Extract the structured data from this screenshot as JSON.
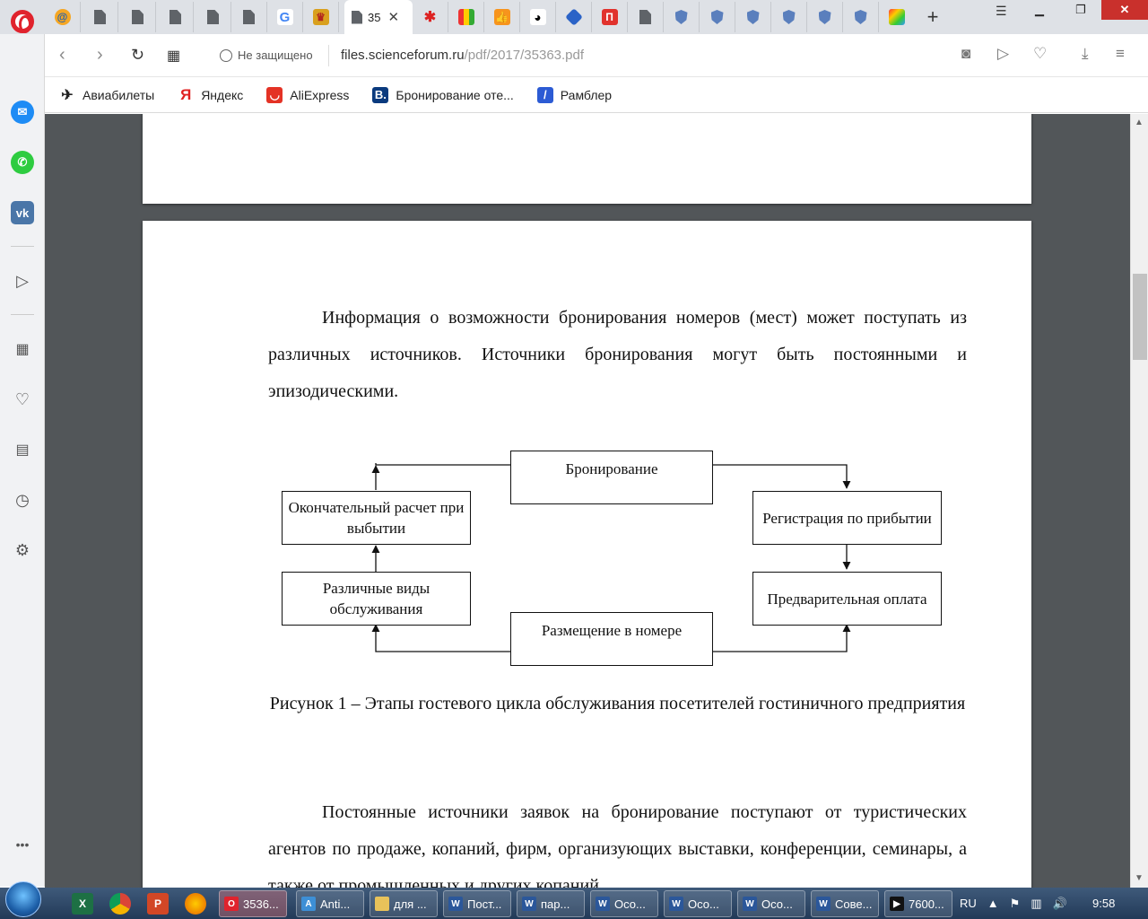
{
  "browser": {
    "tabs": {
      "active_title": "35",
      "close_label": "✕",
      "new_tab_label": "+"
    },
    "address": {
      "insecure_label": "Не защищено",
      "url_host": "files.scienceforum.ru",
      "url_path": "/pdf/2017/35363.pdf"
    },
    "bookmarks": [
      {
        "label": "Авиабилеты",
        "icon": "plane-icon"
      },
      {
        "label": "Яндекс",
        "icon": "yandex-icon"
      },
      {
        "label": "AliExpress",
        "icon": "aliexpress-icon"
      },
      {
        "label": "Бронирование оте...",
        "icon": "booking-icon"
      },
      {
        "label": "Рамблер",
        "icon": "rambler-icon"
      }
    ]
  },
  "document": {
    "paragraph1": "Информация о возможности бронирования номеров (мест) может поступать из различных источников. Источники бронирования могут быть постоянными и эпизодическими.",
    "diagram": {
      "booking": "Бронирование",
      "checkin": "Регистрация по прибытии",
      "prepay": "Предварительная оплата",
      "placement": "Размещение в номере",
      "services": "Различные виды обслуживания",
      "final": "Окончательный расчет при выбытии"
    },
    "caption": "Рисунок 1 – Этапы гостевого цикла обслуживания посетителей гостиничного предприятия",
    "paragraph2": "Постоянные источники заявок на бронирование поступают от туристических агентов по продаже, копаний, фирм, организующих выставки, конференции, семинары, а также от промышленных и других копаний"
  },
  "taskbar": {
    "tasks": [
      "3536...",
      "Anti...",
      "для ...",
      "Пост...",
      "пар...",
      "Осо...",
      "Осо...",
      "Осо...",
      "Сове...",
      "7600..."
    ],
    "language": "RU",
    "time": "9:58"
  },
  "colors": {
    "viewer_bg": "#525659",
    "opera_red": "#e0232d",
    "taskbar": "#2b4566"
  }
}
